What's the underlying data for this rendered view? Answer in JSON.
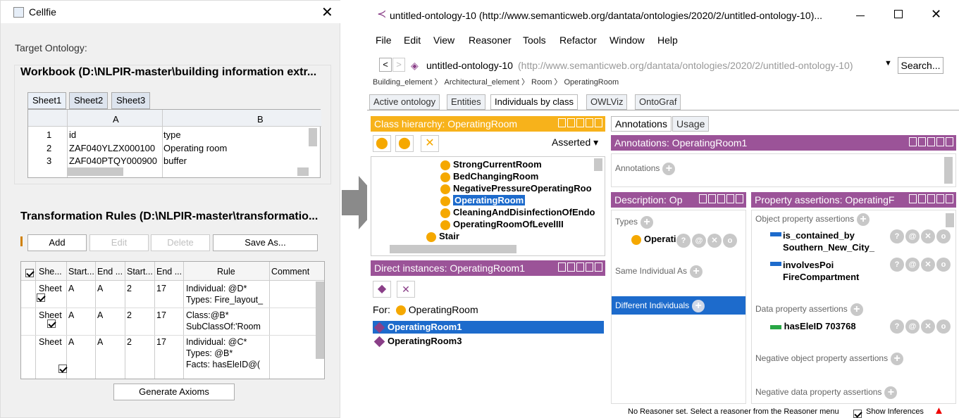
{
  "cellfie": {
    "title": "Cellfie",
    "target_label": "Target Ontology:",
    "workbook_title": "Workbook (D:\\NLPIR-master\\building information extr...",
    "sheets": [
      "Sheet1",
      "Sheet2",
      "Sheet3"
    ],
    "col_a": "A",
    "col_b": "B",
    "rows": [
      {
        "n": "1",
        "a": "id",
        "b": "type"
      },
      {
        "n": "2",
        "a": "ZAF040YLZX000100",
        "b": "Operating room"
      },
      {
        "n": "3",
        "a": "ZAF040PTQY000900",
        "b": "buffer"
      }
    ],
    "rules_title": "Transformation Rules (D:\\NLPIR-master\\transformatio...",
    "buttons": {
      "add": "Add",
      "edit": "Edit",
      "delete": "Delete",
      "save_as": "Save As...",
      "generate": "Generate Axioms"
    },
    "rule_headers": [
      "She...",
      "Start...",
      "End ...",
      "Start...",
      "End ...",
      "Rule",
      "Comment"
    ],
    "rules": [
      {
        "sheet": "Sheet",
        "start_col": "A",
        "end_col": "A",
        "start_row": "2",
        "end_row": "17",
        "rule1": "Individual: @D*",
        "rule2": "Types: Fire_layout_",
        "rule3": ""
      },
      {
        "sheet": "Sheet",
        "start_col": "A",
        "end_col": "A",
        "start_row": "2",
        "end_row": "17",
        "rule1": "Class:@B*",
        "rule2": "SubClassOf:'Room",
        "rule3": ""
      },
      {
        "sheet": "Sheet",
        "start_col": "A",
        "end_col": "A",
        "start_row": "2",
        "end_row": "17",
        "rule1": "Individual: @C*",
        "rule2": "Types: @B*",
        "rule3": "Facts: hasEleID@("
      }
    ]
  },
  "protege": {
    "title": "untitled-ontology-10 (http://www.semanticweb.org/dantata/ontologies/2020/2/untitled-ontology-10)...",
    "menu": [
      "File",
      "Edit",
      "View",
      "Reasoner",
      "Tools",
      "Refactor",
      "Window",
      "Help"
    ],
    "ontology_name": "untitled-ontology-10",
    "ontology_iri": "(http://www.semanticweb.org/dantata/ontologies/2020/2/untitled-ontology-10)",
    "search": "Search...",
    "breadcrumb": [
      "Building_element",
      "Architectural_element",
      "Room",
      "OperatingRoom"
    ],
    "tabs": [
      "Active ontology",
      "Entities",
      "Individuals by class",
      "OWLViz",
      "OntoGraf"
    ],
    "class_hierarchy_title": "Class hierarchy: OperatingRoom",
    "asserted": "Asserted",
    "classes": [
      "StrongCurrentRoom",
      "BedChangingRoom",
      "NegativePressureOperatingRoo",
      "OperatingRoom",
      "CleaningAndDisinfectionOfEndo",
      "OperatingRoomOfLevelIII",
      "Stair"
    ],
    "direct_instances_title": "Direct instances: OperatingRoom1",
    "for_label": "For:",
    "for_value": "OperatingRoom",
    "instances": [
      "OperatingRoom1",
      "OperatingRoom3"
    ],
    "right_tabs": [
      "Annotations",
      "Usage"
    ],
    "annotations_title": "Annotations: OperatingRoom1",
    "annotations_label": "Annotations",
    "description_title": "Description: Op",
    "types_label": "Types",
    "type_value": "Operati",
    "same_individual": "Same Individual As",
    "different_individuals": "Different Individuals",
    "property_title": "Property assertions: OperatingF",
    "object_prop_label": "Object property assertions",
    "obj_props": [
      {
        "p": "is_contained_by",
        "v": "Southern_New_City_"
      },
      {
        "p": "involvesPoi",
        "v": "FireCompartment"
      }
    ],
    "data_prop_label": "Data property assertions",
    "data_prop": {
      "p": "hasEleID",
      "v": "703768"
    },
    "neg_obj": "Negative object property assertions",
    "neg_data": "Negative data property assertions",
    "status": "No Reasoner set. Select a reasoner from the Reasoner menu",
    "show_inferences": "Show Inferences"
  },
  "colors": {
    "orange": "#f7b21b",
    "purple": "#9b5398",
    "select": "#1d6bcc"
  }
}
